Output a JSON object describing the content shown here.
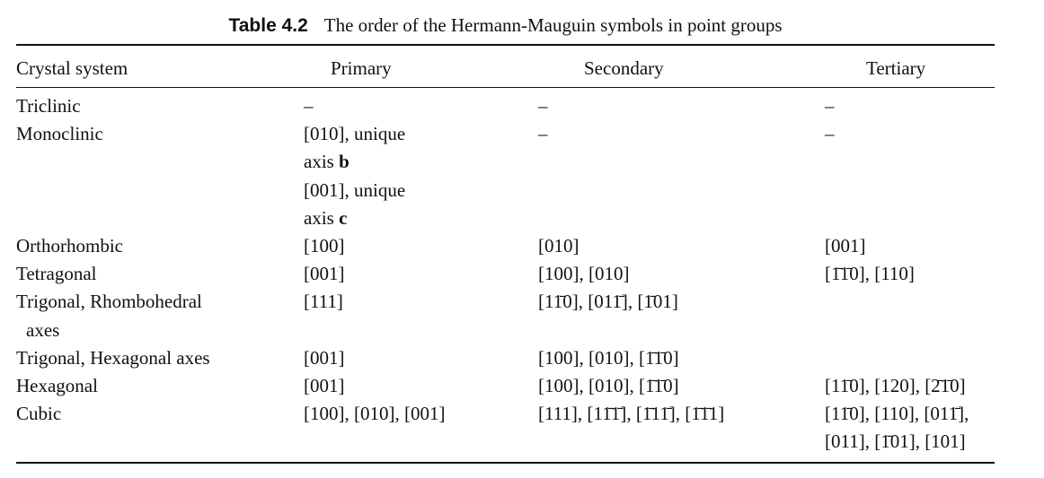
{
  "caption": {
    "label": "Table 4.2",
    "text": "The order of the Hermann-Mauguin symbols in point groups"
  },
  "table": {
    "headers": [
      "Crystal system",
      "Primary",
      "Secondary",
      "Tertiary"
    ],
    "rows": [
      {
        "system": [
          "Triclinic"
        ],
        "primary": [
          "–"
        ],
        "secondary": [
          "–"
        ],
        "tertiary": [
          "–"
        ]
      },
      {
        "system": [
          "Monoclinic"
        ],
        "primary": [
          "[010], unique",
          "axis b",
          "[001], unique",
          "axis c"
        ],
        "secondary": [
          "–"
        ],
        "tertiary": [
          "–"
        ]
      },
      {
        "system": [
          "Orthorhombic"
        ],
        "primary": [
          "[100]"
        ],
        "secondary": [
          "[010]"
        ],
        "tertiary": [
          "[001]"
        ]
      },
      {
        "system": [
          "Tetragonal"
        ],
        "primary": [
          "[001]"
        ],
        "secondary": [
          "[100], [010]"
        ],
        "tertiary": [
          "[1̄1̄0], [110]"
        ]
      },
      {
        "system": [
          "Trigonal, Rhombohedral",
          "axes"
        ],
        "primary": [
          "[111]"
        ],
        "secondary": [
          "[11̄0], [011̄], [1̄​01]"
        ],
        "tertiary": []
      },
      {
        "system": [
          "Trigonal, Hexagonal axes"
        ],
        "primary": [
          "[001]"
        ],
        "secondary": [
          "[100], [010], [1̄1̄0]"
        ],
        "tertiary": []
      },
      {
        "system": [
          "Hexagonal"
        ],
        "primary": [
          "[001]"
        ],
        "secondary": [
          "[100], [010], [1̄1̄0]"
        ],
        "tertiary": [
          "[11̄0], [120], [2̄1̄0]"
        ]
      },
      {
        "system": [
          "Cubic"
        ],
        "primary": [
          "[100], [010], [001]"
        ],
        "secondary": [
          "[111], [11̄1̄], [1̄11̄], [1̄1̄1]"
        ],
        "tertiary": [
          "[11̄0], [110], [011̄],",
          "[011], [1̄01], [101]"
        ]
      }
    ]
  }
}
